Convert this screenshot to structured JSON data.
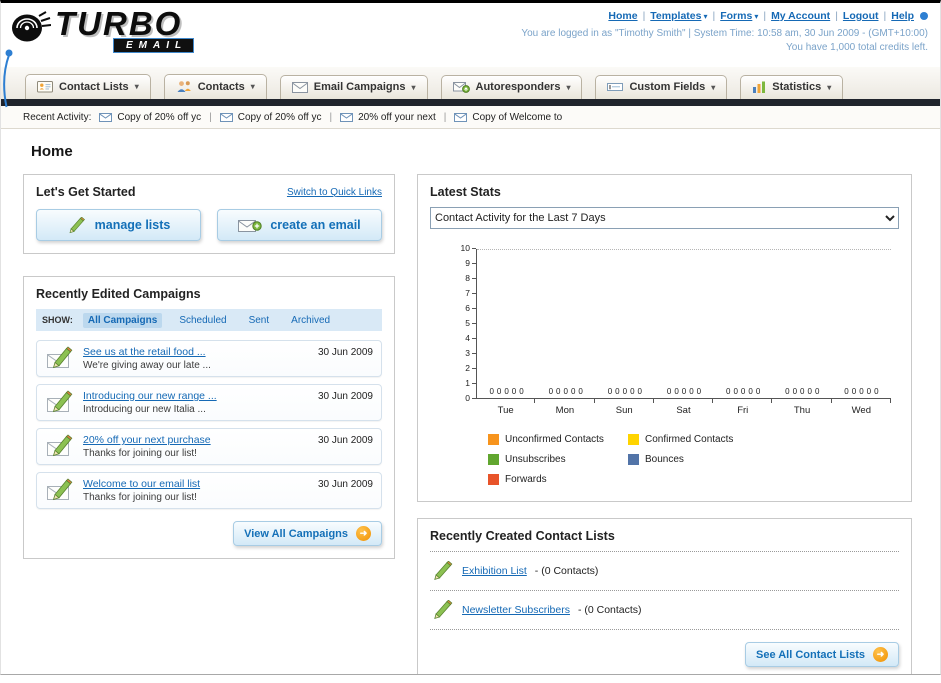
{
  "header": {
    "logo_line1": "TURBO",
    "logo_line2": "EMAIL",
    "links": [
      {
        "label": "Home",
        "dropdown": false
      },
      {
        "label": "Templates",
        "dropdown": true
      },
      {
        "label": "Forms",
        "dropdown": true
      },
      {
        "label": "My Account",
        "dropdown": false
      },
      {
        "label": "Logout",
        "dropdown": false
      },
      {
        "label": "Help",
        "dropdown": false
      }
    ],
    "separator": "|",
    "login_info": "You are logged in as \"Timothy Smith\" | System Time: 10:58 am, 30 Jun 2009 - (GMT+10:00)",
    "credits_info": "You have 1,000 total credits left."
  },
  "nav": {
    "tabs": [
      {
        "label": "Contact Lists",
        "icon": "contact-lists-icon"
      },
      {
        "label": "Contacts",
        "icon": "contacts-icon"
      },
      {
        "label": "Email Campaigns",
        "icon": "email-campaigns-icon"
      },
      {
        "label": "Autoresponders",
        "icon": "autoresponders-icon"
      },
      {
        "label": "Custom Fields",
        "icon": "custom-fields-icon"
      },
      {
        "label": "Statistics",
        "icon": "statistics-icon"
      }
    ]
  },
  "recent_activity": {
    "label": "Recent Activity:",
    "separator": "|",
    "items": [
      "Copy of 20% off yc",
      "Copy of 20% off yc",
      "20% off your next",
      "Copy of Welcome to"
    ]
  },
  "page_title": "Home",
  "get_started": {
    "title": "Let's Get Started",
    "switch_link": "Switch to Quick Links",
    "manage_lists_label": "manage lists",
    "create_email_label": "create an email"
  },
  "campaigns": {
    "title": "Recently Edited Campaigns",
    "show_label": "SHOW:",
    "filters": [
      "All Campaigns",
      "Scheduled",
      "Sent",
      "Archived"
    ],
    "active_filter": "All Campaigns",
    "items": [
      {
        "title": "See us at the retail food ...",
        "subtitle": "We're giving away our late ...",
        "date": "30 Jun 2009"
      },
      {
        "title": "Introducing our new range ...",
        "subtitle": "Introducing our new Italia ...",
        "date": "30 Jun 2009"
      },
      {
        "title": "20% off your next purchase",
        "subtitle": "Thanks for joining our list!",
        "date": "30 Jun 2009"
      },
      {
        "title": "Welcome to our email list",
        "subtitle": "Thanks for joining our list!",
        "date": "30 Jun 2009"
      }
    ],
    "view_all_label": "View All Campaigns"
  },
  "stats": {
    "title": "Latest Stats",
    "selected_option": "Contact Activity for the Last 7 Days",
    "chart_data": {
      "type": "bar",
      "title": "Contact Activity for the Last 7 Days",
      "categories": [
        "Tue",
        "Mon",
        "Sun",
        "Sat",
        "Fri",
        "Thu",
        "Wed"
      ],
      "series": [
        {
          "name": "Unconfirmed Contacts",
          "color": "#f7941d",
          "values": [
            0,
            0,
            0,
            0,
            0,
            0,
            0
          ]
        },
        {
          "name": "Confirmed Contacts",
          "color": "#ffd400",
          "values": [
            0,
            0,
            0,
            0,
            0,
            0,
            0
          ]
        },
        {
          "name": "Unsubscribes",
          "color": "#61a62f",
          "values": [
            0,
            0,
            0,
            0,
            0,
            0,
            0
          ]
        },
        {
          "name": "Bounces",
          "color": "#5274a8",
          "values": [
            0,
            0,
            0,
            0,
            0,
            0,
            0
          ]
        },
        {
          "name": "Forwards",
          "color": "#e8542a",
          "values": [
            0,
            0,
            0,
            0,
            0,
            0,
            0
          ]
        }
      ],
      "ylim": [
        0,
        10
      ],
      "y_ticks": [
        10,
        9,
        8,
        7,
        6,
        5,
        4,
        3,
        2,
        1,
        0
      ],
      "legend_position": "bottom",
      "show_value_labels": true,
      "grid": "top-dotted-line-only"
    }
  },
  "contact_lists": {
    "title": "Recently Created Contact Lists",
    "items": [
      {
        "name": "Exhibition List",
        "detail": "- (0 Contacts)"
      },
      {
        "name": "Newsletter Subscribers",
        "detail": "- (0 Contacts)"
      }
    ],
    "see_all_label": "See All Contact Lists"
  },
  "colors": {
    "link_blue": "#1569b5",
    "accent_orange": "#f09000",
    "dark_bar": "#20242c"
  }
}
